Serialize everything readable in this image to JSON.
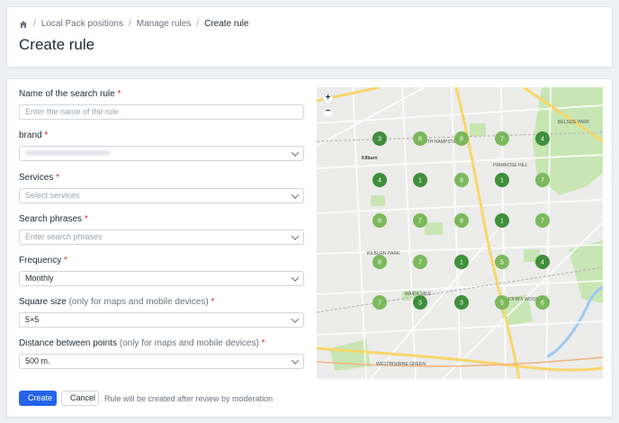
{
  "breadcrumb": {
    "items": [
      "Local Pack positions",
      "Manage rules",
      "Create rule"
    ]
  },
  "page_title": "Create rule",
  "form": {
    "rule_name": {
      "label": "Name of the search rule",
      "required": "*",
      "placeholder": "Enter the name of the rule"
    },
    "brand": {
      "label": "brand",
      "required": "*"
    },
    "services": {
      "label": "Services",
      "required": "*",
      "placeholder": "Select services"
    },
    "search_phrases": {
      "label": "Search phrases",
      "required": "*",
      "placeholder": "Enter search phrases"
    },
    "frequency": {
      "label": "Frequency",
      "required": "*",
      "value": "Monthly"
    },
    "square_size": {
      "label": "Square size",
      "hint": "(only for maps and mobile devices)",
      "required": "*",
      "value": "5×5"
    },
    "distance": {
      "label": "Distance between points",
      "hint": "(only for maps and mobile devices)",
      "required": "*",
      "value": "500 m."
    }
  },
  "actions": {
    "create_label": "Create",
    "cancel_label": "Cancel",
    "note": "Rule will be created after review by moderation"
  },
  "map": {
    "zoom_in": "+",
    "zoom_out": "−",
    "grid_markers": [
      [
        3,
        8,
        8,
        7,
        4
      ],
      [
        4,
        1,
        8,
        1,
        7
      ],
      [
        6,
        7,
        8,
        1,
        7
      ],
      [
        8,
        7,
        1,
        5,
        4
      ],
      [
        7,
        3,
        3,
        5,
        6
      ]
    ],
    "marker_colors": {
      "dark": "#3f8f3b",
      "light": "#7cb85c"
    },
    "labels": [
      "Kilburn",
      "SOUTH HAMPSTEAD",
      "BELSIZE PARK",
      "PRIMROSE HILL",
      "ST JOHN'S WOOD",
      "MAIDA VALE",
      "WESTBOURNE GREEN",
      "KILBURN PARK"
    ]
  }
}
